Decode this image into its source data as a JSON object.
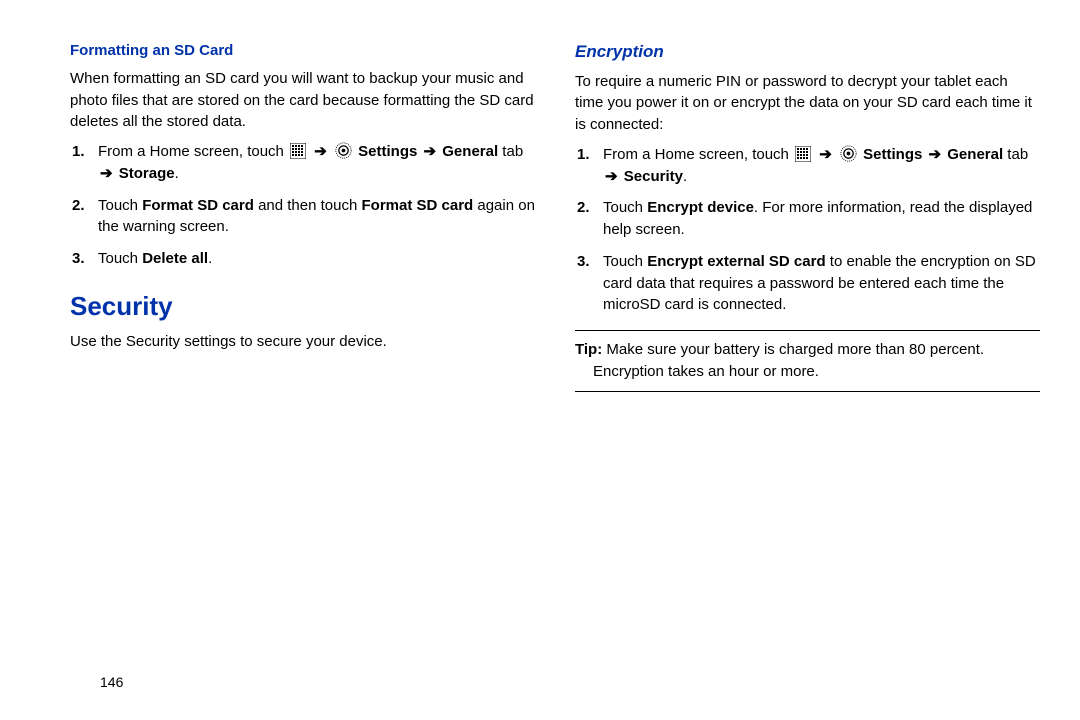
{
  "left": {
    "heading_formatting": "Formatting an SD Card",
    "formatting_para": "When formatting an SD card you will want to backup your music and photo files that are stored on the card because formatting the SD card deletes all the stored data.",
    "step1_pre": "From a Home screen, touch ",
    "settings_word": " Settings ",
    "general_word": "General",
    "tab_word": " tab ",
    "storage_word": "Storage",
    "period": ".",
    "step2_a": "Touch ",
    "step2_b": "Format SD card",
    "step2_c": " and then touch ",
    "step2_d": "Format SD card",
    "step2_e": " again on the warning screen.",
    "step3_a": "Touch ",
    "step3_b": "Delete all",
    "heading_security": "Security",
    "security_para": "Use the Security settings to secure your device."
  },
  "right": {
    "heading_encryption": "Encryption",
    "encryption_para": "To require a numeric PIN or password to decrypt your tablet each time you power it on or encrypt the data on your SD card each time it is connected:",
    "step1_pre": "From a Home screen, touch ",
    "settings_word": " Settings ",
    "general_word": "General",
    "tab_word": " tab ",
    "security_word": "Security",
    "period": ".",
    "step2_a": "Touch ",
    "step2_b": "Encrypt device",
    "step2_c": ". For more information, read the displayed help screen.",
    "step3_a": "Touch ",
    "step3_b": "Encrypt external SD card",
    "step3_c": " to enable the encryption on SD card data that requires a password be entered each time the microSD card is connected.",
    "tip_label": "Tip:",
    "tip_text_a": " Make sure your battery is charged more than 80 percent.",
    "tip_text_b": "Encryption takes an hour or more."
  },
  "arrow": "➔",
  "page_number": "146"
}
